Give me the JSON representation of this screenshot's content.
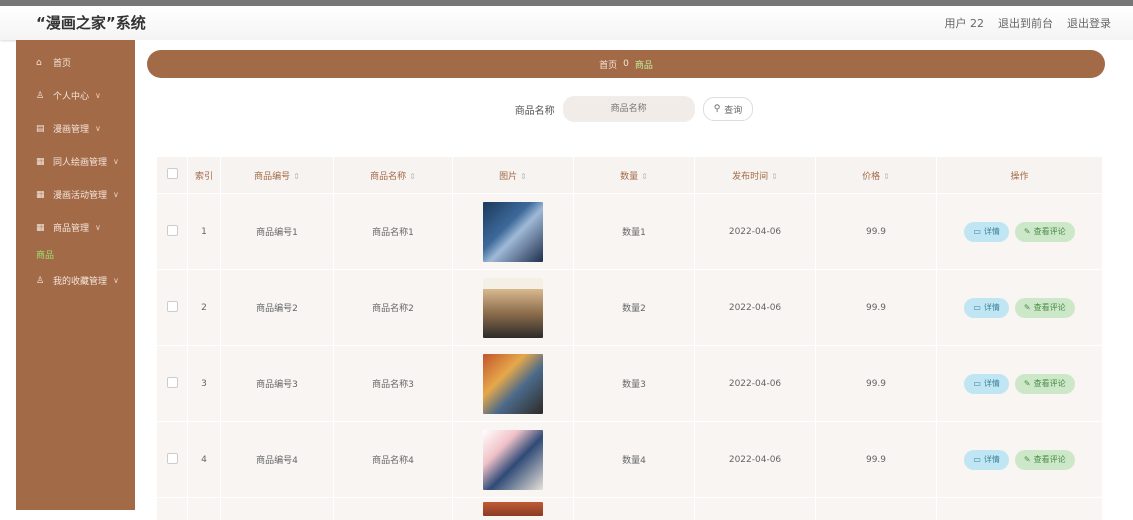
{
  "app": {
    "title": "“漫画之家”系统"
  },
  "topbar": {
    "user": "用户 22",
    "back_label": "退出到前台",
    "logout_label": "退出登录"
  },
  "sidebar": {
    "items": [
      {
        "label": "首页",
        "icon": "home-icon"
      },
      {
        "label": "个人中心",
        "icon": "user-icon"
      },
      {
        "label": "漫画管理",
        "icon": "book-icon"
      },
      {
        "label": "同人绘画管理",
        "icon": "grid-icon"
      },
      {
        "label": "漫画活动管理",
        "icon": "grid-icon"
      },
      {
        "label": "商品管理",
        "icon": "grid-icon"
      },
      {
        "label": "我的收藏管理",
        "icon": "user-icon"
      }
    ],
    "sub_item": "商品"
  },
  "breadcrumb": {
    "home": "首页",
    "separator": "0",
    "current": "商品"
  },
  "search": {
    "label": "商品名称",
    "placeholder": "商品名称",
    "button_label": "查询"
  },
  "table": {
    "columns": [
      "索引",
      "商品编号",
      "商品名称",
      "图片",
      "数量",
      "发布时间",
      "价格",
      "操作"
    ],
    "rows": [
      {
        "index": "1",
        "code": "商品编号1",
        "name": "商品名称1",
        "qty": "数量1",
        "date": "2022-04-06",
        "price": "99.9"
      },
      {
        "index": "2",
        "code": "商品编号2",
        "name": "商品名称2",
        "qty": "数量2",
        "date": "2022-04-06",
        "price": "99.9"
      },
      {
        "index": "3",
        "code": "商品编号3",
        "name": "商品名称3",
        "qty": "数量3",
        "date": "2022-04-06",
        "price": "99.9"
      },
      {
        "index": "4",
        "code": "商品编号4",
        "name": "商品名称4",
        "qty": "数量4",
        "date": "2022-04-06",
        "price": "99.9"
      }
    ],
    "detail_label": "详情",
    "review_label": "查看评论"
  },
  "colors": {
    "accent": "#a36a47",
    "active": "#9be36f",
    "detail": "#bfe6f2",
    "review": "#cde8c9"
  }
}
